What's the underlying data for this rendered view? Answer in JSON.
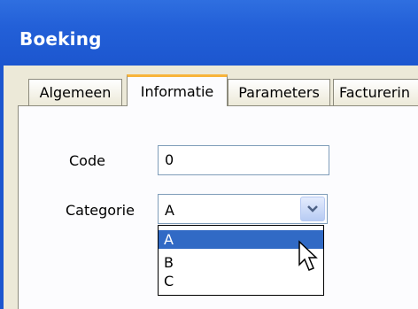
{
  "window": {
    "title": "Boeking"
  },
  "tabs": [
    {
      "label": "Algemeen",
      "active": false
    },
    {
      "label": "Informatie",
      "active": true
    },
    {
      "label": "Parameters",
      "active": false
    },
    {
      "label": "Facturerin",
      "active": false
    }
  ],
  "form": {
    "code": {
      "label": "Code",
      "value": "0"
    },
    "categorie": {
      "label": "Categorie",
      "value": "A",
      "options": [
        "A",
        "B",
        "C"
      ],
      "highlighted": "A"
    }
  },
  "colors": {
    "titlebar": "#2360d8",
    "selection": "#316ac5",
    "active_tab_accent": "#f8b43a"
  }
}
